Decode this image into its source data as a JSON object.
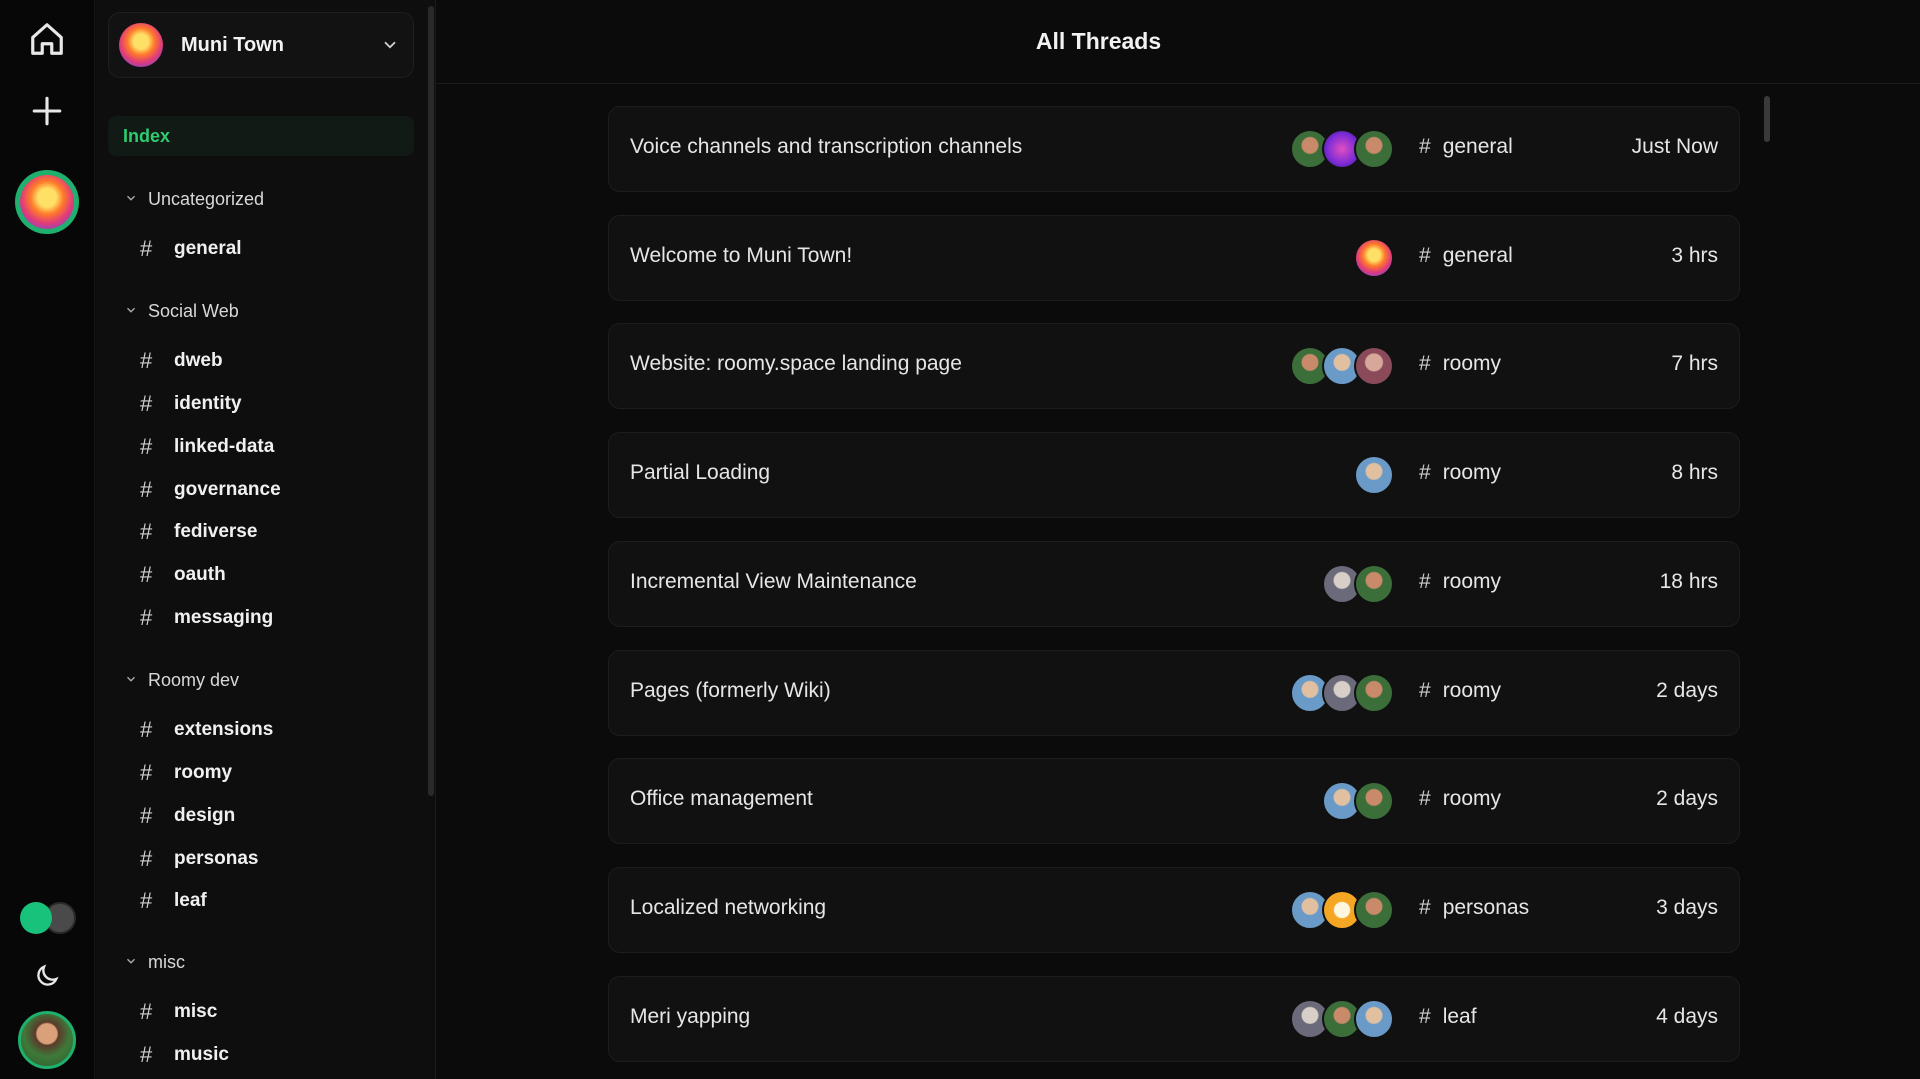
{
  "rail": {
    "icons": [
      "home-icon",
      "plus-icon",
      "moon-icon"
    ],
    "colors": {
      "accent": "#1fb06e",
      "toggle_on": "#19c27a"
    }
  },
  "sidebar": {
    "space_name": "Muni Town",
    "index_label": "Index",
    "categories": [
      {
        "label": "Uncategorized",
        "channels": [
          "general"
        ]
      },
      {
        "label": "Social Web",
        "channels": [
          "dweb",
          "identity",
          "linked-data",
          "governance",
          "fediverse",
          "oauth",
          "messaging"
        ]
      },
      {
        "label": "Roomy dev",
        "channels": [
          "extensions",
          "roomy",
          "design",
          "personas",
          "leaf"
        ]
      },
      {
        "label": "misc",
        "channels": [
          "misc",
          "music"
        ]
      }
    ]
  },
  "main": {
    "title": "All Threads",
    "threads": [
      {
        "title": "Voice channels and transcription channels",
        "channel": "general",
        "time": "Just Now"
      },
      {
        "title": "Welcome to Muni Town!",
        "channel": "general",
        "time": "3 hrs"
      },
      {
        "title": "Website: roomy.space landing page",
        "channel": "roomy",
        "time": "7 hrs"
      },
      {
        "title": "Partial Loading",
        "channel": "roomy",
        "time": "8 hrs"
      },
      {
        "title": "Incremental View Maintenance",
        "channel": "roomy",
        "time": "18 hrs"
      },
      {
        "title": "Pages (formerly Wiki)",
        "channel": "roomy",
        "time": "2 days"
      },
      {
        "title": "Office management",
        "channel": "roomy",
        "time": "2 days"
      },
      {
        "title": "Localized networking",
        "channel": "personas",
        "time": "3 days"
      },
      {
        "title": "Meri yapping",
        "channel": "leaf",
        "time": "4 days"
      }
    ]
  }
}
